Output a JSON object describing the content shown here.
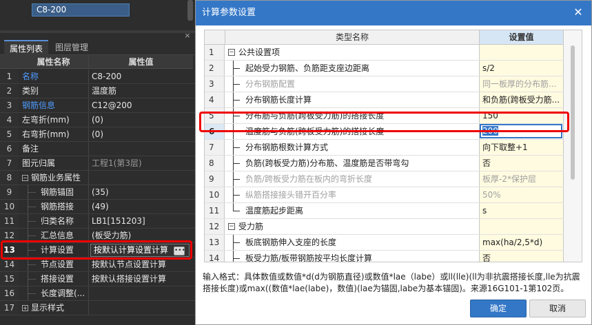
{
  "left_panel": {
    "top_list_item": "C8-200",
    "tabs": [
      "属性列表",
      "图层管理"
    ],
    "close_glyph": "×",
    "headers": {
      "name": "属性名称",
      "value": "属性值"
    },
    "rows": [
      {
        "num": "1",
        "name": "名称",
        "value": "C8-200",
        "name_color": "blue"
      },
      {
        "num": "2",
        "name": "类别",
        "value": "温度筋"
      },
      {
        "num": "3",
        "name": "钢筋信息",
        "value": "C12@200",
        "name_color": "blue"
      },
      {
        "num": "4",
        "name": "左弯折(mm)",
        "value": "(0)"
      },
      {
        "num": "5",
        "name": "右弯折(mm)",
        "value": "(0)"
      },
      {
        "num": "6",
        "name": "备注",
        "value": ""
      },
      {
        "num": "7",
        "name": "图元归属",
        "value": "工程1(第3层)",
        "value_color": "gray"
      },
      {
        "num": "8",
        "name": "钢筋业务属性",
        "value": "",
        "expander": "−"
      },
      {
        "num": "9",
        "name": "钢筋锚固",
        "value": "(35)"
      },
      {
        "num": "10",
        "name": "钢筋搭接",
        "value": "(49)"
      },
      {
        "num": "11",
        "name": "归类名称",
        "value": "LB1[151203]"
      },
      {
        "num": "12",
        "name": "汇总信息",
        "value": "(板受力筋)"
      },
      {
        "num": "13",
        "name": "计算设置",
        "value": "按默认计算设置计算",
        "selected": true
      },
      {
        "num": "14",
        "name": "节点设置",
        "value": "按默认节点设置计算"
      },
      {
        "num": "15",
        "name": "搭接设置",
        "value": "按默认搭接设置计算"
      },
      {
        "num": "16",
        "name": "长度调整(...",
        "value": ""
      },
      {
        "num": "17",
        "name": "显示样式",
        "value": "",
        "expander": "+"
      }
    ]
  },
  "dialog": {
    "title": "计算参数设置",
    "close_glyph": "✕",
    "headers": {
      "name": "类型名称",
      "value": "设置值"
    },
    "rows": [
      {
        "num": "1",
        "name": "公共设置项",
        "value": "",
        "group": true
      },
      {
        "num": "2",
        "name": "起始受力钢筋、负筋距支座边距离",
        "value": "s/2"
      },
      {
        "num": "3",
        "name": "分布钢筋配置",
        "value": "同一板厚的分布筋...",
        "disabled": true
      },
      {
        "num": "4",
        "name": "分布钢筋长度计算",
        "value": "和负筋(跨板受力筋..."
      },
      {
        "num": "5",
        "name": "分布筋与负筋(跨板受力筋)的搭接长度",
        "value": "150"
      },
      {
        "num": "6",
        "name": "温度筋与负筋(跨板受力筋)的搭接长度",
        "value": "200",
        "selected": true
      },
      {
        "num": "7",
        "name": "分布钢筋根数计算方式",
        "value": "向下取整+1"
      },
      {
        "num": "8",
        "name": "负筋(跨板受力筋)分布筋、温度筋是否带弯勾",
        "value": "否"
      },
      {
        "num": "9",
        "name": "负筋/跨板受力筋在板内的弯折长度",
        "value": "板厚-2*保护层",
        "disabled": true
      },
      {
        "num": "10",
        "name": "纵筋搭接接头错开百分率",
        "value": "50%",
        "disabled": true
      },
      {
        "num": "11",
        "name": "温度筋起步距离",
        "value": "s"
      },
      {
        "num": "12",
        "name": "受力筋",
        "value": "",
        "group": true
      },
      {
        "num": "13",
        "name": "板底钢筋伸入支座的长度",
        "value": "max(ha/2,5*d)"
      },
      {
        "num": "14",
        "name": "板受力筋/板带钢筋按平均长度计算",
        "value": "否"
      },
      {
        "num": "15",
        "name": "面筋(单标注跨板受力筋)伸入支座的锚固长度",
        "value": "能直锚就直锚,否则..."
      },
      {
        "num": "16",
        "name": "受力筋根数计算方式",
        "value": "向上取整+1"
      }
    ],
    "hint": "输入格式：具体数值或数值*d(d为钢筋直径)或数值*lae（labe）或ll(lle)(ll为非抗震搭接长度,lle为抗震搭接长度)或max((数值*lae(labe)，数值)(lae为锚固,labe为基本锚固)。来源16G101-1第102页。",
    "ok_label": "确定",
    "cancel_label": "取消"
  },
  "colors": {
    "accent": "#3477c7",
    "highlight_red": "#e00000",
    "value_cell_bg": "#fffbe0",
    "property_blue": "#4f9bff"
  },
  "icons": [
    "close-icon",
    "ellipsis-icon",
    "expand-icon",
    "collapse-icon"
  ]
}
